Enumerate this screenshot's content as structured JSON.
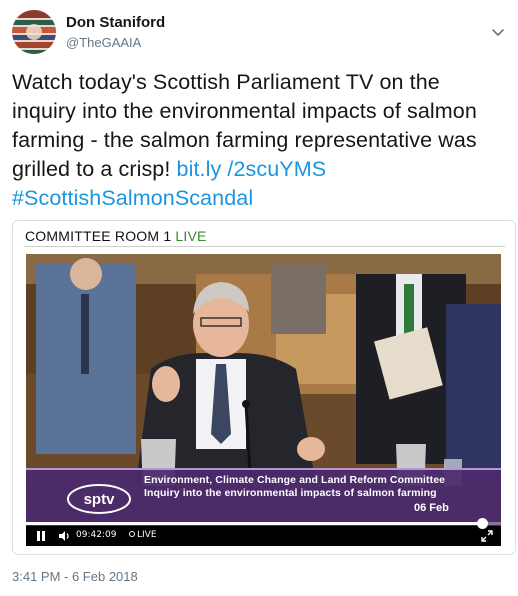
{
  "author": {
    "display_name": "Don Staniford",
    "handle": "@TheGAAIA",
    "avatar_icon": "avatar-image"
  },
  "tweet": {
    "text": "Watch today's Scottish Parliament TV on the inquiry into the environmental impacts of salmon farming - the salmon farming representative was grilled to a crisp! ",
    "link_text": "bit.ly /2scuYMS",
    "hashtag": "#ScottishSalmonScandal",
    "timestamp": "3:41 PM - 6 Feb 2018"
  },
  "media": {
    "room_label": "COMMITTEE ROOM 1",
    "live_label": "LIVE",
    "lower_third": {
      "logo_text": "sptv",
      "committee": "Environment, Climate Change and Land Reform Committee",
      "inquiry": "Inquiry into the environmental impacts of salmon farming",
      "date": "06 Feb"
    },
    "player": {
      "time": "09:42:09",
      "live_text": "LIVE",
      "progress_fraction": 0.96
    }
  },
  "colors": {
    "link": "#1b95e0",
    "live_green": "#3a8a2e",
    "lower_third_purple": "#4b2a6e"
  },
  "icons": {
    "caret": "chevron-down-icon",
    "pause": "pause-icon",
    "volume": "volume-icon",
    "fullscreen": "fullscreen-icon"
  }
}
